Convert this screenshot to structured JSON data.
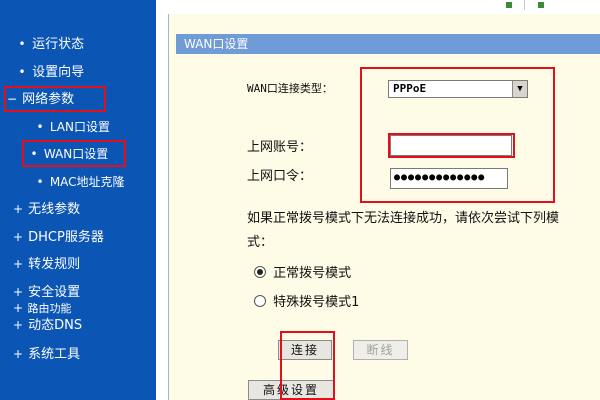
{
  "sidebar": {
    "items": [
      {
        "label": "运行状态",
        "bullet": "•"
      },
      {
        "label": "设置向导",
        "bullet": "•"
      },
      {
        "label": "网络参数",
        "bullet": "−"
      },
      {
        "label": "LAN口设置",
        "bullet": "•"
      },
      {
        "label": "WAN口设置",
        "bullet": "•"
      },
      {
        "label": "MAC地址克隆",
        "bullet": "•"
      },
      {
        "label": "无线参数",
        "bullet": "+"
      },
      {
        "label": "DHCP服务器",
        "bullet": "+"
      },
      {
        "label": "转发规则",
        "bullet": "+"
      },
      {
        "label": "安全设置",
        "bullet": "+"
      },
      {
        "label": "路由功能",
        "bullet": "+"
      },
      {
        "label": "动态DNS",
        "bullet": "+"
      },
      {
        "label": "系统工具",
        "bullet": "+"
      }
    ]
  },
  "content": {
    "header_title": "WAN口设置",
    "wan_type_label": "WAN口连接类型：",
    "wan_type_value": "PPPoE",
    "account_label": "上网账号：",
    "account_value": "",
    "password_label": "上网口令：",
    "password_value": "●●●●●●●●●●●●●",
    "hint_line1": "如果正常拨号模式下无法连接成功，请依次尝试下列模",
    "hint_line2": "式：",
    "radio_normal": "正常拨号模式",
    "radio_special": "特殊拨号模式1",
    "connect_button": "连接",
    "disconnect_button": "断线",
    "advanced_button": "高级设置"
  },
  "colors": {
    "sidebar_bg": "#0b55b5",
    "header_bg": "#6f9bd6",
    "content_bg": "#fefbe6",
    "highlight": "#e3101c"
  }
}
